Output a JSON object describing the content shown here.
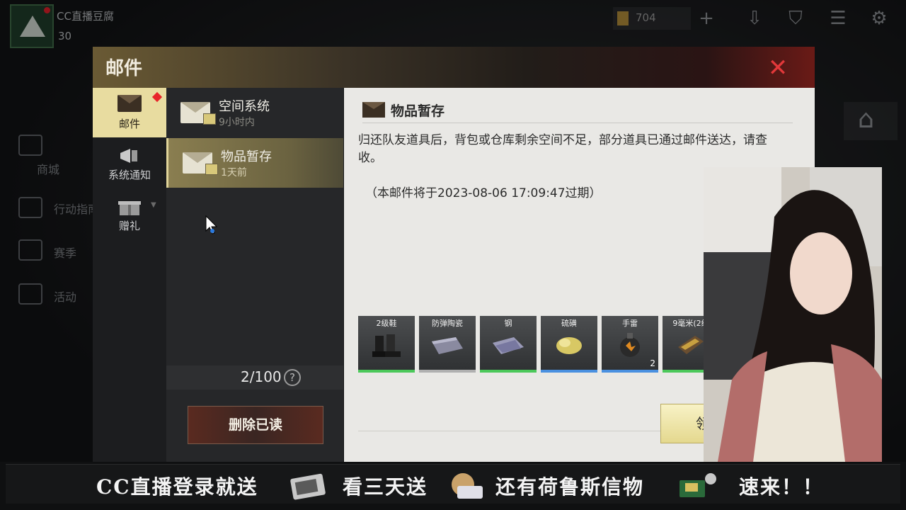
{
  "hud": {
    "player_name": "CC直播豆腐",
    "player_level": "30",
    "currency_value": "704",
    "left_menu": [
      "商城",
      "行动指南",
      "赛季",
      "活动"
    ]
  },
  "dialog": {
    "title": "邮件",
    "categories": [
      {
        "label": "邮件",
        "icon": "envelope-icon",
        "active": true,
        "has_badge": true
      },
      {
        "label": "系统通知",
        "icon": "megaphone-icon",
        "active": false
      },
      {
        "label": "赠礼",
        "icon": "gift-icon",
        "active": false
      }
    ],
    "mails": [
      {
        "title": "空间系统",
        "time": "9小时内",
        "active": false
      },
      {
        "title": "物品暂存",
        "time": "1天前",
        "active": true
      }
    ],
    "count": "2/100",
    "delete_read_label": "删除已读",
    "detail": {
      "title": "物品暂存",
      "body": "归还队友道具后，背包或仓库剩余空间不足，部分道具已通过邮件送达，请查收。",
      "expire": "（本邮件将于2023-08-06 17:09:47过期）",
      "items": [
        {
          "name": "2级鞋",
          "count": "",
          "rarity_color": "#4cc85a"
        },
        {
          "name": "防弹陶瓷",
          "count": "",
          "rarity_color": "#b0b0b0"
        },
        {
          "name": "钢",
          "count": "",
          "rarity_color": "#4cc85a"
        },
        {
          "name": "硫磺",
          "count": "",
          "rarity_color": "#4a90e0"
        },
        {
          "name": "手雷",
          "count": "2",
          "rarity_color": "#4a90e0"
        },
        {
          "name": "9毫米(2级",
          "count": "",
          "rarity_color": "#4cc85a"
        }
      ],
      "claim_label": "领"
    }
  },
  "banner": {
    "part1": "CC直播登录就送",
    "part2": "看三天送",
    "part3": "还有荷鲁斯信物",
    "part4": "速来！！"
  },
  "colors": {
    "accent_gold": "#e8dca0",
    "close_red": "#e2383a",
    "badge_red": "#e8242a"
  }
}
